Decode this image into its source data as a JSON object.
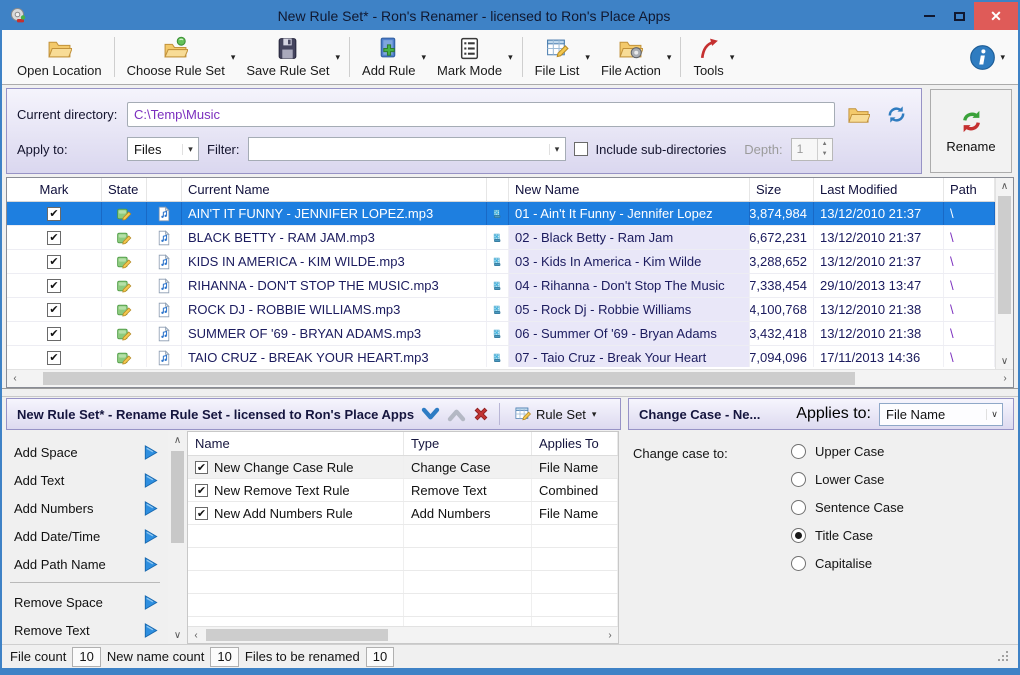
{
  "window": {
    "title": "New Rule Set* - Ron's Renamer - licensed to Ron's Place Apps"
  },
  "toolbar": {
    "items": [
      {
        "label": "Open Location",
        "icon": "open-location-icon",
        "caret": false
      },
      {
        "label": "Choose Rule Set",
        "icon": "choose-rule-set-icon",
        "caret": true
      },
      {
        "label": "Save Rule Set",
        "icon": "save-rule-set-icon",
        "caret": true
      },
      {
        "label": "Add Rule",
        "icon": "add-rule-icon",
        "caret": true
      },
      {
        "label": "Mark Mode",
        "icon": "mark-mode-icon",
        "caret": true
      },
      {
        "label": "File List",
        "icon": "file-list-icon",
        "caret": true
      },
      {
        "label": "File Action",
        "icon": "file-action-icon",
        "caret": true
      },
      {
        "label": "Tools",
        "icon": "tools-icon",
        "caret": true
      }
    ],
    "separators_after": [
      0,
      2,
      4,
      6
    ],
    "info_caret": "▾"
  },
  "directory_panel": {
    "current_directory_label": "Current directory:",
    "current_directory_value": "C:\\Temp\\Music",
    "apply_to_label": "Apply to:",
    "apply_to_value": "Files",
    "filter_label": "Filter:",
    "filter_value": "",
    "include_subdirs_label": "Include sub-directories",
    "include_subdirs_checked": false,
    "depth_label": "Depth:",
    "depth_value": "1",
    "rename_label": "Rename"
  },
  "file_table": {
    "columns": [
      "Mark",
      "State",
      "",
      "Current Name",
      "",
      "New Name",
      "Size",
      "Last Modified",
      "Path"
    ],
    "rows": [
      {
        "marked": true,
        "current": "AIN'T IT FUNNY - JENNIFER LOPEZ.mp3",
        "new": "01 - Ain't It Funny - Jennifer Lopez",
        "size": "3,874,984",
        "modified": "13/12/2010 21:37",
        "path": "\\",
        "selected": true
      },
      {
        "marked": true,
        "current": "BLACK BETTY - RAM JAM.mp3",
        "new": "02 - Black Betty - Ram Jam",
        "size": "6,672,231",
        "modified": "13/12/2010 21:37",
        "path": "\\",
        "selected": false
      },
      {
        "marked": true,
        "current": "KIDS IN AMERICA - KIM WILDE.mp3",
        "new": "03 - Kids In America - Kim Wilde",
        "size": "3,288,652",
        "modified": "13/12/2010 21:37",
        "path": "\\",
        "selected": false
      },
      {
        "marked": true,
        "current": "RIHANNA - DON'T STOP THE MUSIC.mp3",
        "new": "04 - Rihanna - Don't Stop The Music",
        "size": "7,338,454",
        "modified": "29/10/2013 13:47",
        "path": "\\",
        "selected": false
      },
      {
        "marked": true,
        "current": "ROCK DJ - ROBBIE WILLIAMS.mp3",
        "new": "05 - Rock Dj - Robbie Williams",
        "size": "4,100,768",
        "modified": "13/12/2010 21:38",
        "path": "\\",
        "selected": false
      },
      {
        "marked": true,
        "current": "SUMMER OF '69 - BRYAN ADAMS.mp3",
        "new": "06 - Summer Of '69 - Bryan Adams",
        "size": "3,432,418",
        "modified": "13/12/2010 21:38",
        "path": "\\",
        "selected": false
      },
      {
        "marked": true,
        "current": "TAIO CRUZ - BREAK YOUR HEART.mp3",
        "new": "07 - Taio Cruz - Break Your Heart",
        "size": "7,094,096",
        "modified": "17/11/2013 14:36",
        "path": "\\",
        "selected": false
      }
    ]
  },
  "rule_panel": {
    "left_title": "New Rule Set* - Rename Rule Set - licensed to Ron's Place Apps",
    "ruleset_button_label": "Rule Set",
    "ruleset_caret": "▾",
    "right_title": "Change Case - Ne...",
    "applies_to_label": "Applies to:",
    "applies_to_value": "File Name"
  },
  "rule_sidebar": {
    "items": [
      "Add Space",
      "Add Text",
      "Add Numbers",
      "Add Date/Time",
      "Add Path Name",
      "Remove Space",
      "Remove Text"
    ],
    "divider_after_index": 4
  },
  "rules_table": {
    "columns": [
      "Name",
      "Type",
      "Applies To"
    ],
    "rows": [
      {
        "checked": true,
        "name": "New Change Case Rule",
        "type": "Change Case",
        "applies": "File Name",
        "selected": true
      },
      {
        "checked": true,
        "name": "New Remove Text Rule",
        "type": "Remove Text",
        "applies": "Combined",
        "selected": false
      },
      {
        "checked": true,
        "name": "New Add Numbers Rule",
        "type": "Add Numbers",
        "applies": "File Name",
        "selected": false
      }
    ],
    "empty_rows": 5
  },
  "change_case": {
    "label": "Change case to:",
    "options": [
      "Upper Case",
      "Lower Case",
      "Sentence Case",
      "Title Case",
      "Capitalise"
    ],
    "selected": "Title Case"
  },
  "status_bar": {
    "items": [
      {
        "label": "File count",
        "value": "10"
      },
      {
        "label": "New name count",
        "value": "10"
      },
      {
        "label": "Files to be renamed",
        "value": "10"
      }
    ]
  },
  "colors": {
    "titlebar": "#3E82C6",
    "close_button": "#DF5B58",
    "selection": "#1E7FE0",
    "directory_text": "#7B2FBE",
    "newname_column": "#E9E7F8"
  }
}
